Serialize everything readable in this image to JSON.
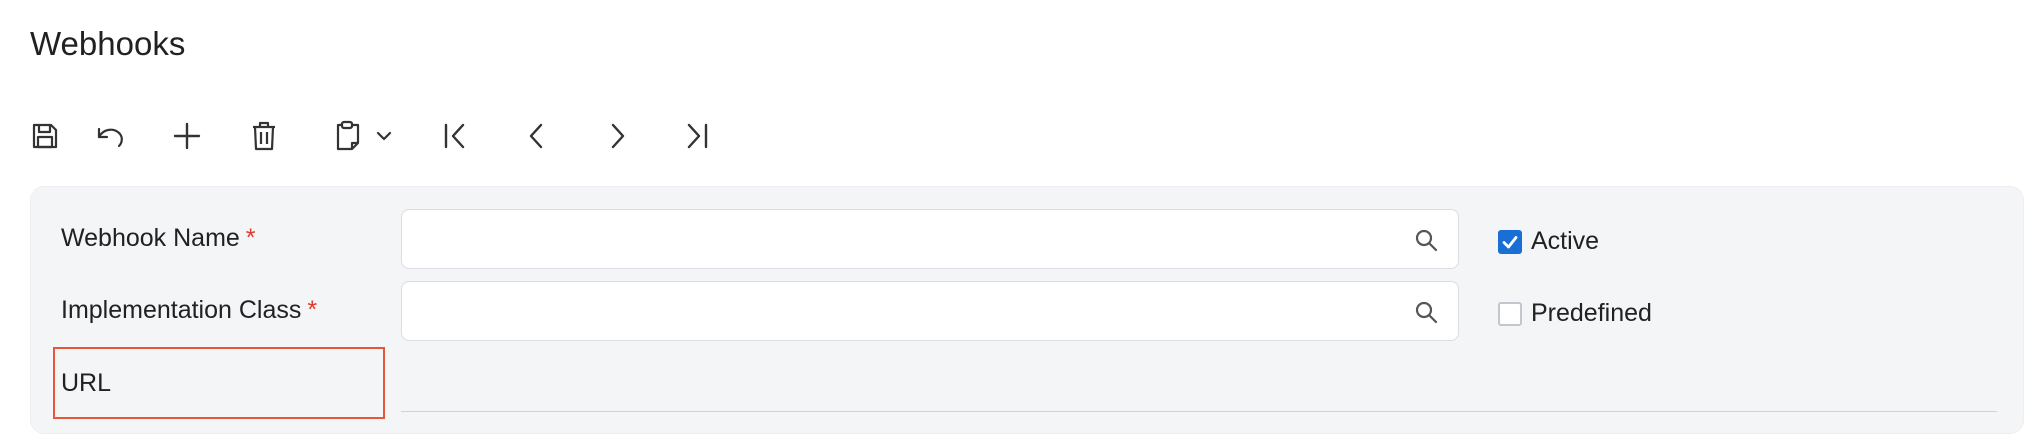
{
  "page": {
    "title": "Webhooks"
  },
  "toolbar": {
    "buttons": [
      {
        "name": "save-button",
        "icon": "floppy-disk-icon"
      },
      {
        "name": "undo-button",
        "icon": "undo-icon"
      },
      {
        "name": "add-button",
        "icon": "plus-icon"
      },
      {
        "name": "delete-button",
        "icon": "trash-icon"
      },
      {
        "name": "clipboard-dropdown-button",
        "icon": "clipboard-icon"
      },
      {
        "name": "first-record-button",
        "icon": "first-page-icon"
      },
      {
        "name": "previous-record-button",
        "icon": "chevron-left-icon"
      },
      {
        "name": "next-record-button",
        "icon": "chevron-right-icon"
      },
      {
        "name": "last-record-button",
        "icon": "last-page-icon"
      }
    ]
  },
  "form": {
    "webhook_name": {
      "label": "Webhook Name",
      "required_mark": "*",
      "value": ""
    },
    "implementation_class": {
      "label": "Implementation Class",
      "required_mark": "*",
      "value": ""
    },
    "url": {
      "label": "URL",
      "value": ""
    },
    "active": {
      "label": "Active",
      "checked": true
    },
    "predefined": {
      "label": "Predefined",
      "checked": false
    }
  },
  "colors": {
    "accent": "#1a6fd6",
    "required": "#e03a2f",
    "highlight_border": "#e8543c",
    "panel_bg": "#f4f5f7"
  }
}
